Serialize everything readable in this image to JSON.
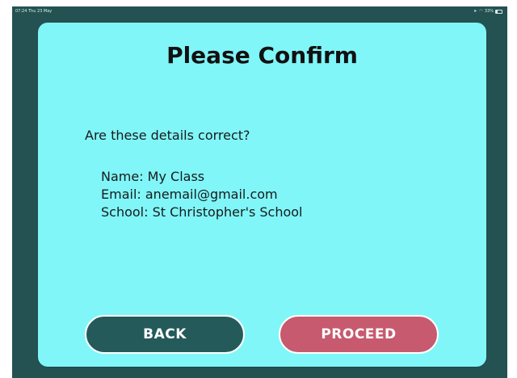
{
  "status_bar": {
    "time_date": "07:24 Thu 23 May",
    "battery": "33%"
  },
  "dialog": {
    "title": "Please Confirm",
    "question": "Are these details correct?",
    "details": [
      "Name: My Class",
      "Email: anemail@gmail.com",
      "School: St Christopher's School"
    ]
  },
  "buttons": {
    "back_label": "BACK",
    "proceed_label": "PROCEED"
  },
  "colors": {
    "background": "#245252",
    "dialog": "#80f6f9",
    "back_button": "#245a5a",
    "proceed_button": "#c75a6e"
  },
  "icons": {
    "status": [
      "location-icon",
      "wifi-icon",
      "battery-icon"
    ]
  }
}
